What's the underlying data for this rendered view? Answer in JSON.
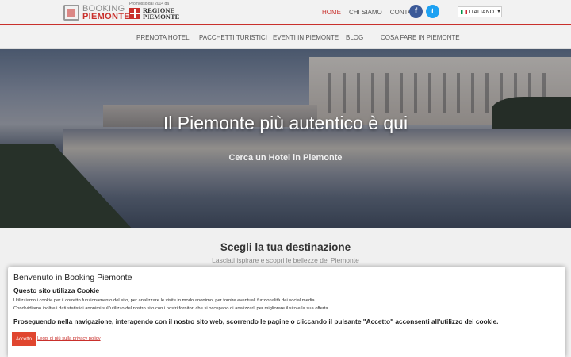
{
  "brand": {
    "line1": "BOOKING",
    "line2": "PIEMONTE"
  },
  "partner": {
    "promo": "Promosso dal 2014 da",
    "line1": "REGIONE",
    "line2": "PIEMONTE"
  },
  "topnav": [
    {
      "label": "HOME",
      "active": true
    },
    {
      "label": "CHI SIAMO",
      "active": false
    },
    {
      "label": "CONTATTI",
      "active": false
    }
  ],
  "social": {
    "facebook": "f",
    "twitter": "t"
  },
  "language": {
    "selected": "ITALIANO",
    "flag": "italy-flag-icon"
  },
  "mainnav": [
    "PRENOTA HOTEL",
    "PACCHETTI TURISTICI",
    "EVENTI IN PIEMONTE",
    "BLOG",
    "COSA FARE IN PIEMONTE"
  ],
  "hero": {
    "title": "Il Piemonte più autentico è qui",
    "subtitle": "Cerca un Hotel in Piemonte"
  },
  "destination": {
    "title": "Scegli la tua destinazione",
    "subtitle": "Lasciati ispirare e scopri le bellezze del Piemonte"
  },
  "cookie": {
    "title": "Benvenuto in Booking Piemonte",
    "subtitle": "Questo sito utilizza Cookie",
    "line1": "Utilizziamo i cookie per il corretto funzionamento del sito, per analizzare le visite in modo anonimo, per fornire eventuali funzionalità dei social media.",
    "line2": "Condividiamo inoltre i dati statistici anonimi sull'utilizzo del nostro sito con i nostri fornitori che si occupano di analizzarli per migliorare il sito e la sua offerta.",
    "bold": "Proseguendo nella navigazione, interagendo con il nostro sito web, scorrendo le pagine o cliccando il pulsante \"Accetto\" acconsenti all'utilizzo dei cookie.",
    "accept": "Accetto",
    "privacy_link": "Leggi di più sulla privacy policy"
  },
  "colors": {
    "accent": "#c9302c",
    "facebook": "#3b5998",
    "twitter": "#1da1f2",
    "accept_button": "#e0462f"
  }
}
